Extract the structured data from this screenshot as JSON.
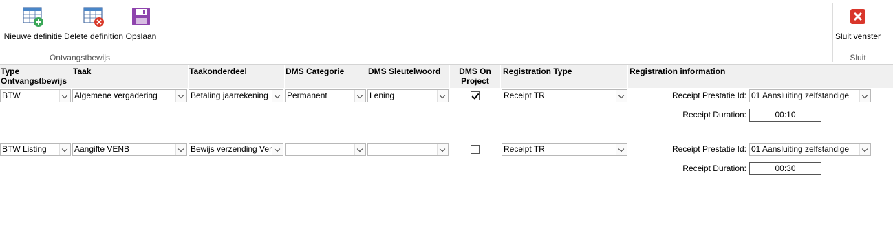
{
  "ribbon": {
    "new_def_label": "Nieuwe definitie",
    "delete_def_label": "Delete definition",
    "save_label": "Opslaan",
    "group_left_label": "Ontvangstbewijs",
    "close_label": "Sluit venster",
    "group_right_label": "Sluit"
  },
  "columns": {
    "type": "Type Ontvangstbewijs",
    "taak": "Taak",
    "taakonderdeel": "Taakonderdeel",
    "dms_categorie": "DMS Categorie",
    "dms_sleutelwoord": "DMS Sleutelwoord",
    "dms_on_project": "DMS On Project",
    "registration_type": "Registration Type",
    "registration_info": "Registration information"
  },
  "rows": [
    {
      "type": "BTW",
      "taak": "Algemene vergadering",
      "taakonderdeel": "Betaling jaarrekening",
      "dms_categorie": "Permanent",
      "dms_sleutelwoord": "Lening",
      "dms_on_project": true,
      "registration_type": "Receipt TR",
      "prestatie_label": "Receipt Prestatie Id:",
      "prestatie_value": "01 Aansluiting zelfstandige",
      "duration_label": "Receipt Duration:",
      "duration_value": "00:10"
    },
    {
      "type": "BTW Listing",
      "taak": "Aangifte VENB",
      "taakonderdeel": "Bewijs verzending Vennootschapsbelasting",
      "dms_categorie": "",
      "dms_sleutelwoord": "",
      "dms_on_project": false,
      "registration_type": "Receipt TR",
      "prestatie_label": "Receipt Prestatie Id:",
      "prestatie_value": "01 Aansluiting zelfstandige",
      "duration_label": "Receipt Duration:",
      "duration_value": "00:30"
    }
  ],
  "colors": {
    "header_bg": "#f0f0f0",
    "add_accent": "#3aa757",
    "delete_accent": "#d93a2b",
    "save_accent": "#8e44ad",
    "close_accent": "#d9362b"
  }
}
